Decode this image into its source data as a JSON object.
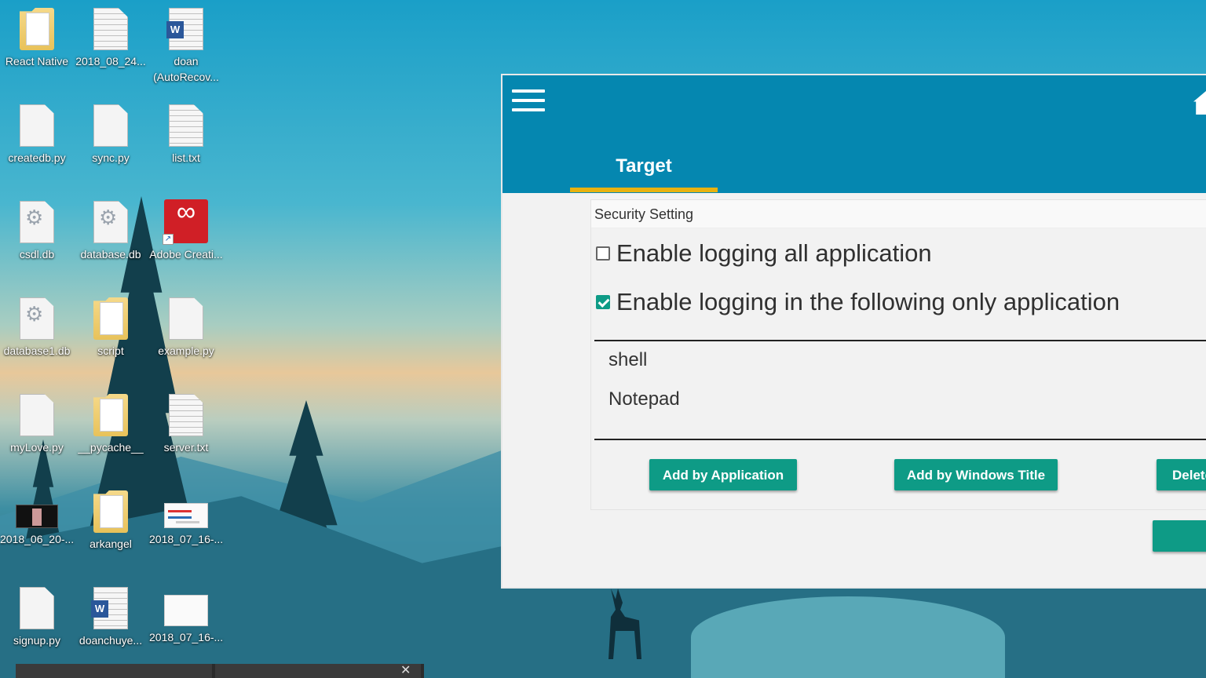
{
  "desktop": {
    "icons": [
      {
        "label": "React Native",
        "type": "folder"
      },
      {
        "label": "2018_08_24...",
        "type": "file"
      },
      {
        "label": "doan (AutoRecov...",
        "type": "word"
      },
      {
        "label": "createdb.py",
        "type": "file"
      },
      {
        "label": "sync.py",
        "type": "file"
      },
      {
        "label": "list.txt",
        "type": "text"
      },
      {
        "label": "csdl.db",
        "type": "db"
      },
      {
        "label": "database.db",
        "type": "db"
      },
      {
        "label": "Adobe Creati...",
        "type": "adobe"
      },
      {
        "label": "database1.db",
        "type": "db"
      },
      {
        "label": "script",
        "type": "folder"
      },
      {
        "label": "example.py",
        "type": "file"
      },
      {
        "label": "myLove.py",
        "type": "file"
      },
      {
        "label": "__pycache__",
        "type": "folder"
      },
      {
        "label": "server.txt",
        "type": "text"
      },
      {
        "label": "2018_06_20-...",
        "type": "video"
      },
      {
        "label": "arkangel",
        "type": "folder"
      },
      {
        "label": "2018_07_16-...",
        "type": "screenshot"
      },
      {
        "label": "signup.py",
        "type": "file"
      },
      {
        "label": "doanchuye...",
        "type": "word"
      },
      {
        "label": "2018_07_16-...",
        "type": "screenshot"
      }
    ]
  },
  "app": {
    "active_tab": "Target",
    "panel": {
      "title": "Security Setting",
      "option_all": {
        "label": "Enable logging all application",
        "checked": false
      },
      "option_only": {
        "label": "Enable logging in the following only application",
        "checked": true
      },
      "applications": [
        "shell",
        "Notepad"
      ],
      "buttons": {
        "add_by_app": "Add by Application",
        "add_by_title": "Add by Windows Title",
        "delete": "Delete"
      }
    }
  },
  "colors": {
    "appbar": "#0587b0",
    "accent": "#0e9b86",
    "tab_indicator": "#e8b20f"
  }
}
